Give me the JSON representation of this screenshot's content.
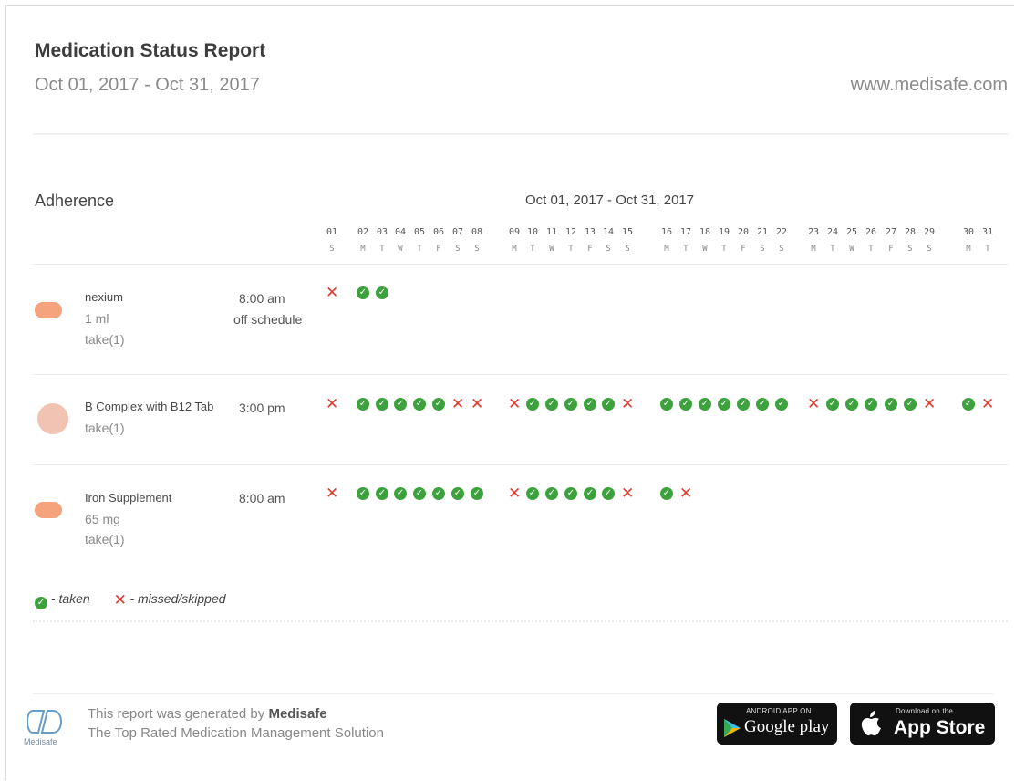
{
  "report": {
    "title": "Medication Status Report",
    "date_range": "Oct 01, 2017 - Oct 31, 2017",
    "website": "www.medisafe.com"
  },
  "adherence": {
    "title": "Adherence",
    "grid_range": "Oct 01, 2017 - Oct 31, 2017",
    "days": [
      {
        "num": "01",
        "dow": "S"
      },
      {
        "num": "02",
        "dow": "M"
      },
      {
        "num": "03",
        "dow": "T"
      },
      {
        "num": "04",
        "dow": "W"
      },
      {
        "num": "05",
        "dow": "T"
      },
      {
        "num": "06",
        "dow": "F"
      },
      {
        "num": "07",
        "dow": "S"
      },
      {
        "num": "08",
        "dow": "S"
      },
      {
        "num": "09",
        "dow": "M"
      },
      {
        "num": "10",
        "dow": "T"
      },
      {
        "num": "11",
        "dow": "W"
      },
      {
        "num": "12",
        "dow": "T"
      },
      {
        "num": "13",
        "dow": "F"
      },
      {
        "num": "14",
        "dow": "S"
      },
      {
        "num": "15",
        "dow": "S"
      },
      {
        "num": "16",
        "dow": "M"
      },
      {
        "num": "17",
        "dow": "T"
      },
      {
        "num": "18",
        "dow": "W"
      },
      {
        "num": "19",
        "dow": "T"
      },
      {
        "num": "20",
        "dow": "F"
      },
      {
        "num": "21",
        "dow": "S"
      },
      {
        "num": "22",
        "dow": "S"
      },
      {
        "num": "23",
        "dow": "M"
      },
      {
        "num": "24",
        "dow": "T"
      },
      {
        "num": "25",
        "dow": "W"
      },
      {
        "num": "26",
        "dow": "T"
      },
      {
        "num": "27",
        "dow": "F"
      },
      {
        "num": "28",
        "dow": "S"
      },
      {
        "num": "29",
        "dow": "S"
      },
      {
        "num": "30",
        "dow": "M"
      },
      {
        "num": "31",
        "dow": "T"
      }
    ],
    "medications": [
      {
        "name": "nexium",
        "dose": "1 ml",
        "take": "take(1)",
        "time": "8:00 am",
        "note": "off schedule",
        "pill_shape": "capsule",
        "pill_color": "#f5a37d",
        "status": [
          "X",
          "T",
          "T",
          "",
          "",
          "",
          "",
          "",
          "",
          "",
          "",
          "",
          "",
          "",
          "",
          "",
          "",
          "",
          "",
          "",
          "",
          "",
          "",
          "",
          "",
          "",
          "",
          "",
          "",
          "",
          ""
        ]
      },
      {
        "name": "B Complex with B12 Tab",
        "dose": "",
        "take": "take(1)",
        "time": "3:00 pm",
        "note": "",
        "pill_shape": "round",
        "pill_color": "#f0c3b3",
        "status": [
          "X",
          "T",
          "T",
          "T",
          "T",
          "T",
          "X",
          "X",
          "X",
          "T",
          "T",
          "T",
          "T",
          "T",
          "X",
          "T",
          "T",
          "T",
          "T",
          "T",
          "T",
          "T",
          "X",
          "T",
          "T",
          "T",
          "T",
          "T",
          "X",
          "T",
          "X"
        ]
      },
      {
        "name": "Iron Supplement",
        "dose": "65 mg",
        "take": "take(1)",
        "time": "8:00 am",
        "note": "",
        "pill_shape": "capsule",
        "pill_color": "#f5a37d",
        "status": [
          "X",
          "T",
          "T",
          "T",
          "T",
          "T",
          "T",
          "T",
          "X",
          "T",
          "T",
          "T",
          "T",
          "T",
          "X",
          "T",
          "X",
          "",
          "",
          "",
          "",
          "",
          "",
          "",
          "",
          "",
          "",
          "",
          "",
          "",
          ""
        ]
      }
    ],
    "legend": {
      "taken": "- taken",
      "missed": "- missed/skipped"
    },
    "colors": {
      "taken": "#3da23d",
      "missed": "#e03a2f"
    }
  },
  "footer": {
    "logo_text": "Medisafe",
    "line1_prefix": "This report was generated by",
    "line1_brand": "Medisafe",
    "line2": "The Top Rated Medication Management Solution",
    "google_play": {
      "small": "ANDROID APP ON",
      "big": "Google play"
    },
    "app_store": {
      "small": "Download on the",
      "big": "App Store"
    }
  }
}
